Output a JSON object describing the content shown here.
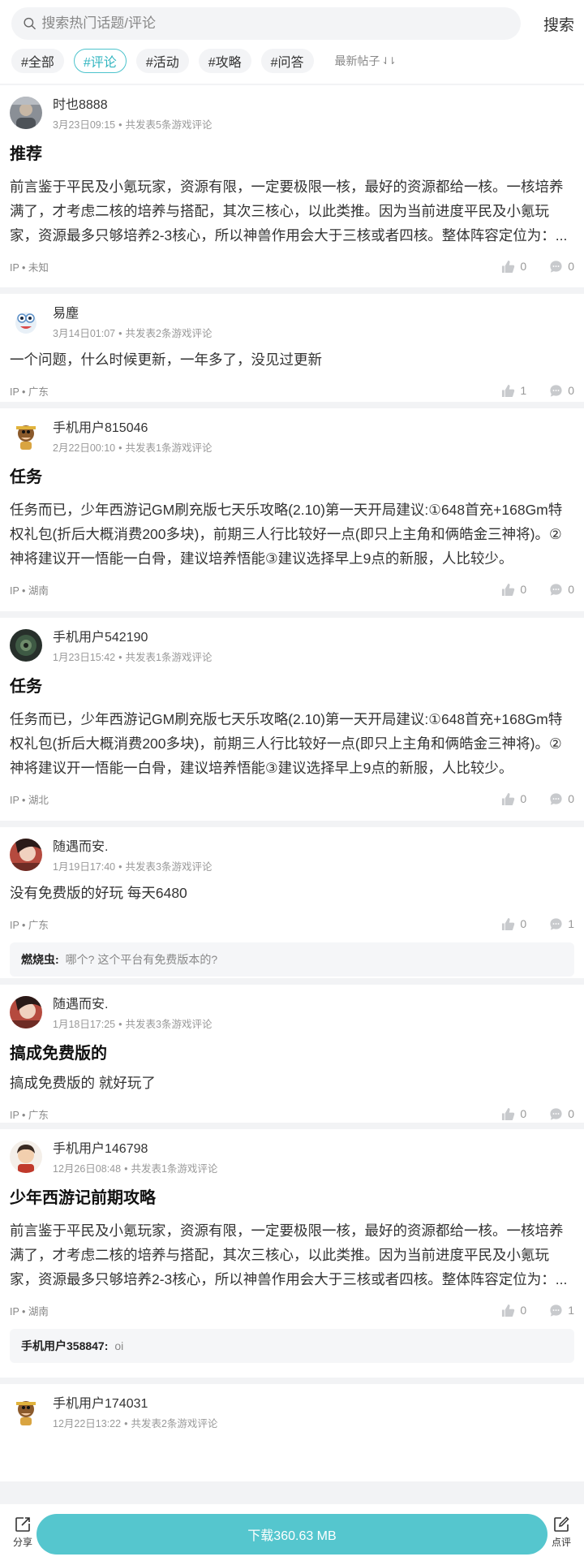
{
  "search": {
    "placeholder": "搜索热门话题/评论",
    "button": "搜索"
  },
  "filters": [
    "#全部",
    "#评论",
    "#活动",
    "#攻略",
    "#问答"
  ],
  "sort_label": "最新帖子",
  "sort_arrows": "⇃⇂",
  "colors": {
    "accent": "#4cc3cc",
    "download": "#55c6ce"
  },
  "posts": [
    {
      "user": "时也8888",
      "date": "3月23日09:15",
      "sep": "•",
      "count": "共发表5条游戏评论",
      "title": "推荐",
      "body": "前言鉴于平民及小氪玩家，资源有限，一定要极限一核，最好的资源都给一核。一核培养满了，才考虑二核的培养与搭配，其次三核心，以此类推。因为当前进度平民及小氪玩家，资源最多只够培养2-3核心，所以神兽作用会大于三核或者四核。整体阵容定位为：...",
      "ip": "IP • 未知",
      "likes": "0",
      "comments": "0"
    },
    {
      "user": "易塵",
      "date": "3月14日01:07",
      "sep": "•",
      "count": "共发表2条游戏评论",
      "body": "一个问题，什么时候更新，一年多了，没见过更新",
      "ip": "IP • 广东",
      "likes": "1",
      "comments": "0"
    },
    {
      "user": "手机用户815046",
      "date": "2月22日00:10",
      "sep": "•",
      "count": "共发表1条游戏评论",
      "title": "任务",
      "body": "任务而已，少年西游记GM刷充版七天乐攻略(2.10)第一天开局建议:①648首充+168Gm特权礼包(折后大概消费200多块)，前期三人行比较好一点(即只上主角和俩皓金三神将)。②神将建议开一悟能一白骨，建议培养悟能③建议选择早上9点的新服，人比较少。",
      "ip": "IP • 湖南",
      "likes": "0",
      "comments": "0"
    },
    {
      "user": "手机用户542190",
      "date": "1月23日15:42",
      "sep": "•",
      "count": "共发表1条游戏评论",
      "title": "任务",
      "body": "任务而已，少年西游记GM刷充版七天乐攻略(2.10)第一天开局建议:①648首充+168Gm特权礼包(折后大概消费200多块)，前期三人行比较好一点(即只上主角和俩皓金三神将)。②神将建议开一悟能一白骨，建议培养悟能③建议选择早上9点的新服，人比较少。",
      "ip": "IP • 湖北",
      "likes": "0",
      "comments": "0"
    },
    {
      "user": "随遇而安.",
      "date": "1月19日17:40",
      "sep": "•",
      "count": "共发表3条游戏评论",
      "body": "没有免费版的好玩 每天6480",
      "ip": "IP • 广东",
      "likes": "0",
      "comments": "1",
      "reply": {
        "user": "燃烧虫:",
        "text": "哪个? 这个平台有免费版本的?"
      }
    },
    {
      "user": "随遇而安.",
      "date": "1月18日17:25",
      "sep": "•",
      "count": "共发表3条游戏评论",
      "title": "搞成免费版的",
      "body": "搞成免费版的 就好玩了",
      "ip": "IP • 广东",
      "likes": "0",
      "comments": "0"
    },
    {
      "user": "手机用户146798",
      "date": "12月26日08:48",
      "sep": "•",
      "count": "共发表1条游戏评论",
      "title": "少年西游记前期攻略",
      "body": "前言鉴于平民及小氪玩家，资源有限，一定要极限一核，最好的资源都给一核。一核培养满了，才考虑二核的培养与搭配，其次三核心，以此类推。因为当前进度平民及小氪玩家，资源最多只够培养2-3核心，所以神兽作用会大于三核或者四核。整体阵容定位为：...",
      "ip": "IP • 湖南",
      "likes": "0",
      "comments": "1",
      "reply": {
        "user": "手机用户358847:",
        "text": "oi"
      }
    },
    {
      "user": "手机用户174031",
      "date": "12月22日13:22",
      "sep": "•",
      "count": "共发表2条游戏评论"
    }
  ],
  "bottom": {
    "share": "分享",
    "download": "下载360.63 MB",
    "review": "点评"
  }
}
